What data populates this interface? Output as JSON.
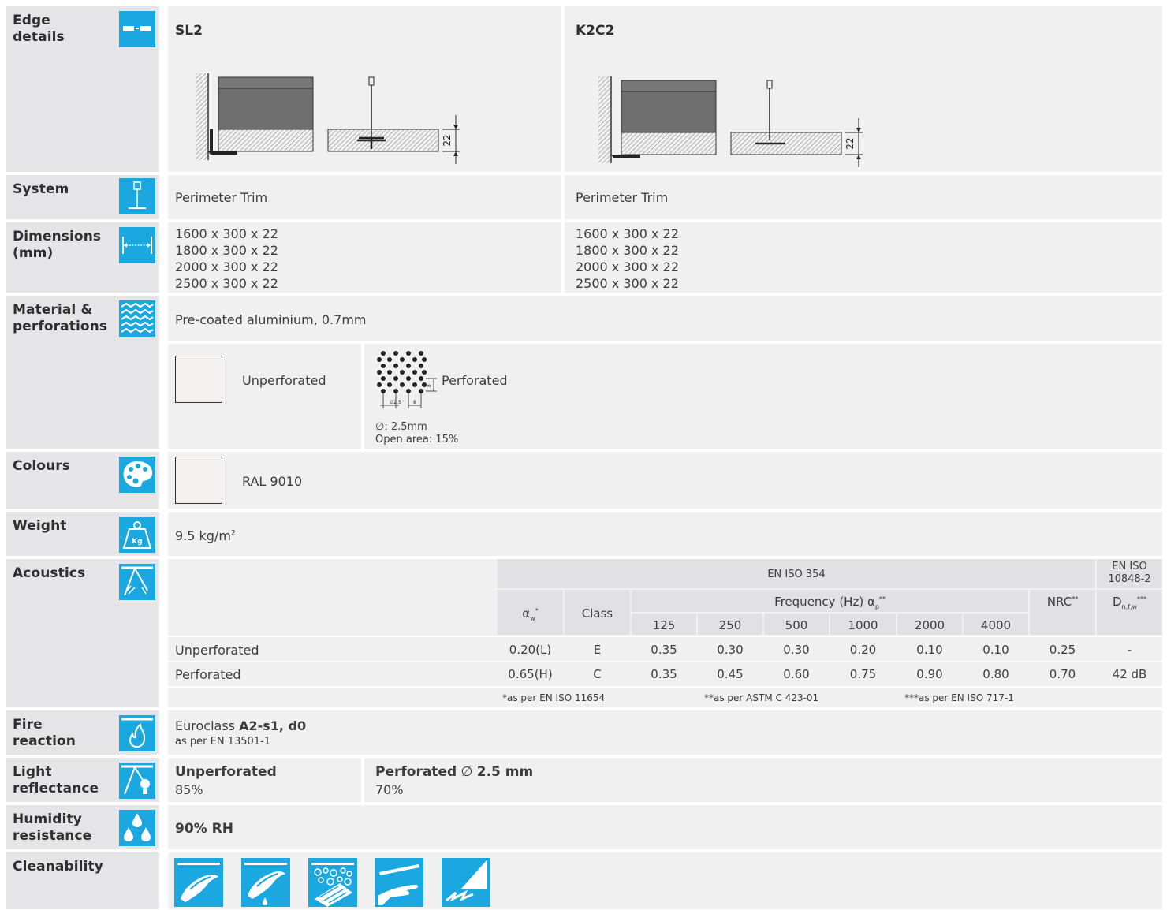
{
  "labels": {
    "edge": "Edge\ndetails",
    "system": "System",
    "dimensions": "Dimensions\n(mm)",
    "material": "Material &\nperforations",
    "colours": "Colours",
    "weight": "Weight",
    "acoustics": "Acoustics",
    "fire": "Fire\nreaction",
    "light": "Light\nreflectance",
    "humidity": "Humidity\nresistance",
    "cleanability": "Cleanability"
  },
  "edge": {
    "col1_title": "SL2",
    "col2_title": "K2C2",
    "dim_label": "22"
  },
  "system": {
    "col1": "Perimeter Trim",
    "col2": "Perimeter Trim"
  },
  "dimensions": {
    "col1": [
      "1600 x 300 x 22",
      "1800 x 300 x 22",
      "2000 x 300 x 22",
      "2500 x 300 x 22"
    ],
    "col2": [
      "1600 x 300 x 22",
      "1800 x 300 x 22",
      "2000 x 300 x 22",
      "2500 x 300 x 22"
    ]
  },
  "material": {
    "description": "Pre-coated aluminium, 0.7mm",
    "unperforated": "Unperforated",
    "perforated": "Perforated",
    "perf_diameter": "∅: 2.5mm",
    "perf_open_area": "Open area: 15%",
    "perf_dim_a": "∅2.5",
    "perf_dim_b": "8",
    "perf_dim_c": "8"
  },
  "colours": {
    "swatch": "RAL 9010",
    "swatch_color": "#f2f1ee"
  },
  "weight": {
    "value": "9.5 kg/m",
    "unit_sup": "2"
  },
  "acoustics": {
    "std1": "EN ISO 354",
    "std2": "EN ISO\n10848-2",
    "aw": "α",
    "aw_sub": "w",
    "aw_sup": "*",
    "class": "Class",
    "freq": "Frequency (Hz) α",
    "freq_sub": "p",
    "freq_sup": "**",
    "nrc": "NRC",
    "nrc_sup": "**",
    "dn": "D",
    "dn_sub": "n,f,w",
    "dn_sup": "***",
    "freqs": [
      "125",
      "250",
      "500",
      "1000",
      "2000",
      "4000"
    ],
    "rows": [
      {
        "name": "Unperforated",
        "aw": "0.20(L)",
        "class": "E",
        "v": [
          "0.35",
          "0.30",
          "0.30",
          "0.20",
          "0.10",
          "0.10"
        ],
        "nrc": "0.25",
        "dn": "-"
      },
      {
        "name": "Perforated",
        "aw": "0.65(H)",
        "class": "C",
        "v": [
          "0.35",
          "0.45",
          "0.60",
          "0.75",
          "0.90",
          "0.80"
        ],
        "nrc": "0.70",
        "dn": "42 dB"
      }
    ],
    "foot1": "*as per EN ISO 11654",
    "foot2": "**as per ASTM C 423-01",
    "foot3": "***as per EN ISO 717-1"
  },
  "fire": {
    "prefix": "Euroclass ",
    "value": "A2-s1, d0",
    "note": "as per EN 13501-1"
  },
  "light": {
    "unperf_label": "Unperforated",
    "unperf_value": "85%",
    "perf_label": "Perforated",
    "perf_symbol": " ∅ ",
    "perf_size": "2.5 mm",
    "perf_value": "70%"
  },
  "humidity": {
    "value": "90% RH"
  },
  "colors": {
    "accent": "#1ba7e0",
    "label_bg": "#e5e5e7",
    "cell_bg": "#f0f0f1"
  }
}
